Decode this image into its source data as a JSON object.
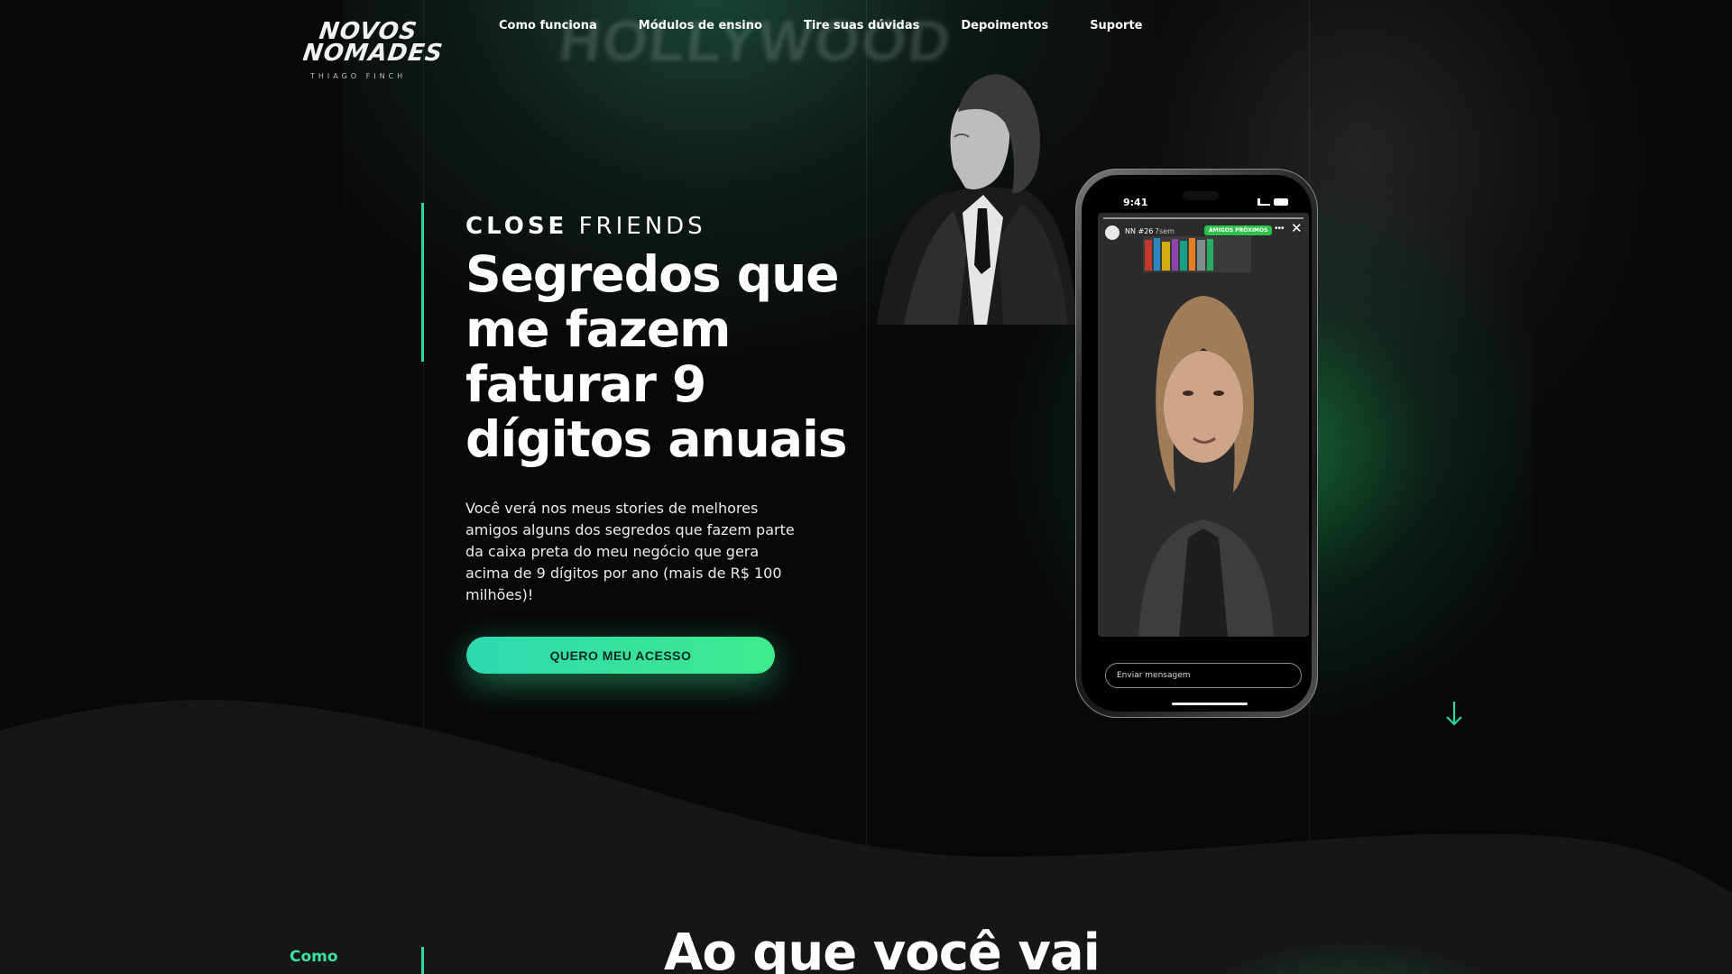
{
  "brand": {
    "logo_line1": "NOVOS",
    "logo_line2": "NOMADES",
    "logo_sub": "THIAGO FINCH"
  },
  "nav": {
    "items": [
      "Como funciona",
      "Módulos de ensino",
      "Tire suas dúvidas",
      "Depoimentos",
      "Suporte"
    ]
  },
  "background": {
    "sign_text": "HOLLYWOOD"
  },
  "hero": {
    "eyebrow_bold": "CLOSE",
    "eyebrow_light": "FRIENDS",
    "title": "Segredos que me fazem faturar 9 dígitos anuais",
    "description": "Você verá nos meus stories de melhores amigos alguns dos segredos que fazem parte da caixa preta do meu negócio que gera acima de 9 dígitos por ano (mais de R$ 100 milhões)!",
    "cta_label": "QUERO MEU ACESSO"
  },
  "phone": {
    "time": "9:41",
    "story_user": "NN #26",
    "story_time": "7sem",
    "badge": "AMIGOS PRÓXIMOS",
    "message_placeholder": "Enviar mensagem"
  },
  "next_section": {
    "side_label": "Como",
    "title": "Ao que você vai"
  },
  "colors": {
    "accent": "#2fd6a1",
    "cta_start": "#2ed9b0",
    "cta_end": "#3fea8c",
    "background": "#080808"
  }
}
